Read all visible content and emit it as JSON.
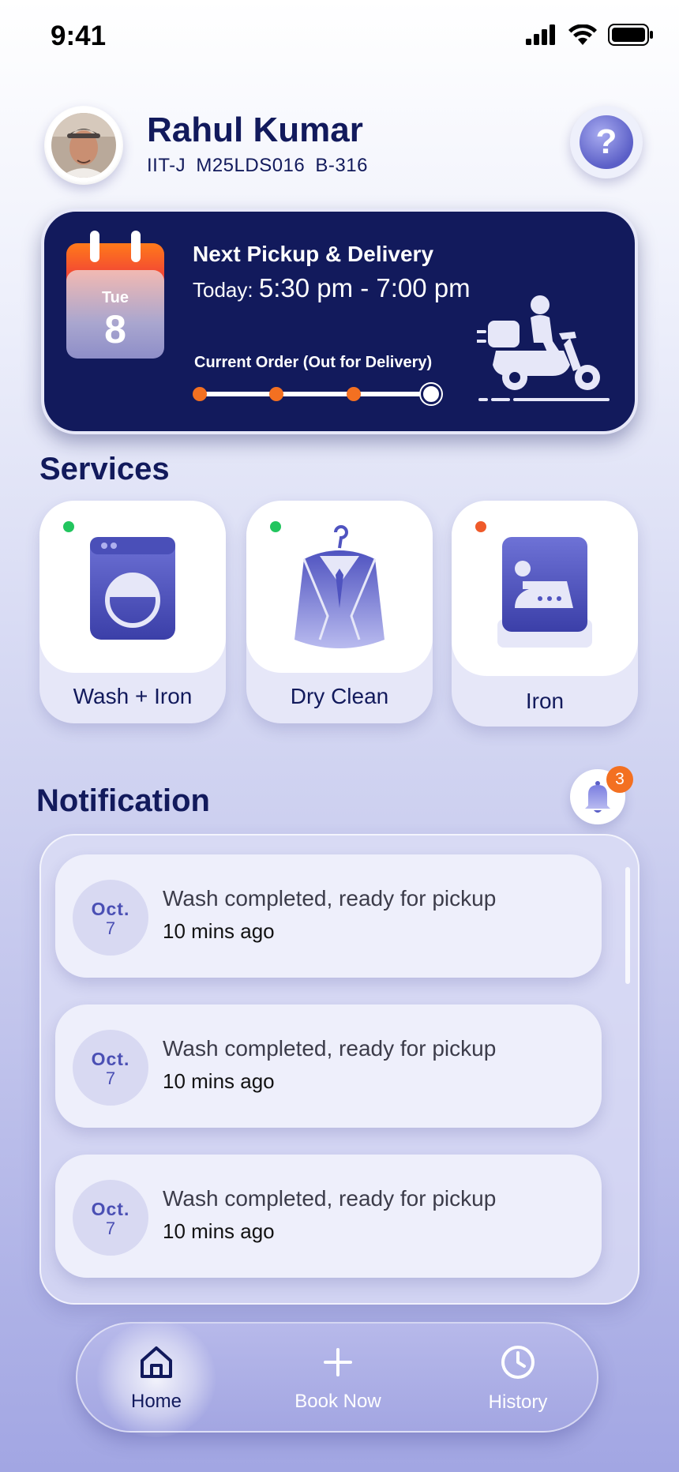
{
  "status_bar": {
    "time": "9:41"
  },
  "profile": {
    "name": "Rahul Kumar",
    "meta": "IIT-J  M25LDS016  B-316"
  },
  "help": {
    "label": "?"
  },
  "delivery": {
    "calendar_day": "Tue",
    "calendar_date": "8",
    "title": "Next Pickup & Delivery",
    "time_prefix": "Today:",
    "time_range": "5:30 pm - 7:00 pm",
    "status": "Current Order (Out for Delivery)",
    "progress_steps_done": 4,
    "progress_steps_total": 4
  },
  "services": {
    "title": "Services",
    "items": [
      {
        "label": "Wash + Iron",
        "available": true,
        "status_color": "#22c55e",
        "icon": "washing-machine-icon"
      },
      {
        "label": "Dry Clean",
        "available": true,
        "status_color": "#22c55e",
        "icon": "suit-hanger-icon"
      },
      {
        "label": "Iron",
        "available": false,
        "status_color": "#ef5a2a",
        "icon": "iron-icon"
      }
    ]
  },
  "notifications": {
    "title": "Notification",
    "badge_count": "3",
    "items": [
      {
        "month": "Oct.",
        "day": "7",
        "text": "Wash completed, ready for pickup",
        "time": "10 mins ago"
      },
      {
        "month": "Oct.",
        "day": "7",
        "text": "Wash completed, ready for pickup",
        "time": "10 mins ago"
      },
      {
        "month": "Oct.",
        "day": "7",
        "text": "Wash completed, ready for pickup",
        "time": "10 mins ago"
      }
    ]
  },
  "nav": {
    "items": [
      {
        "label": "Home",
        "icon": "home-icon",
        "active": true
      },
      {
        "label": "Book Now",
        "icon": "plus-icon",
        "active": false
      },
      {
        "label": "History",
        "icon": "clock-icon",
        "active": false
      }
    ]
  },
  "colors": {
    "navy": "#121a5c",
    "accent_orange": "#f37021",
    "purple": "#5b5fc7"
  }
}
